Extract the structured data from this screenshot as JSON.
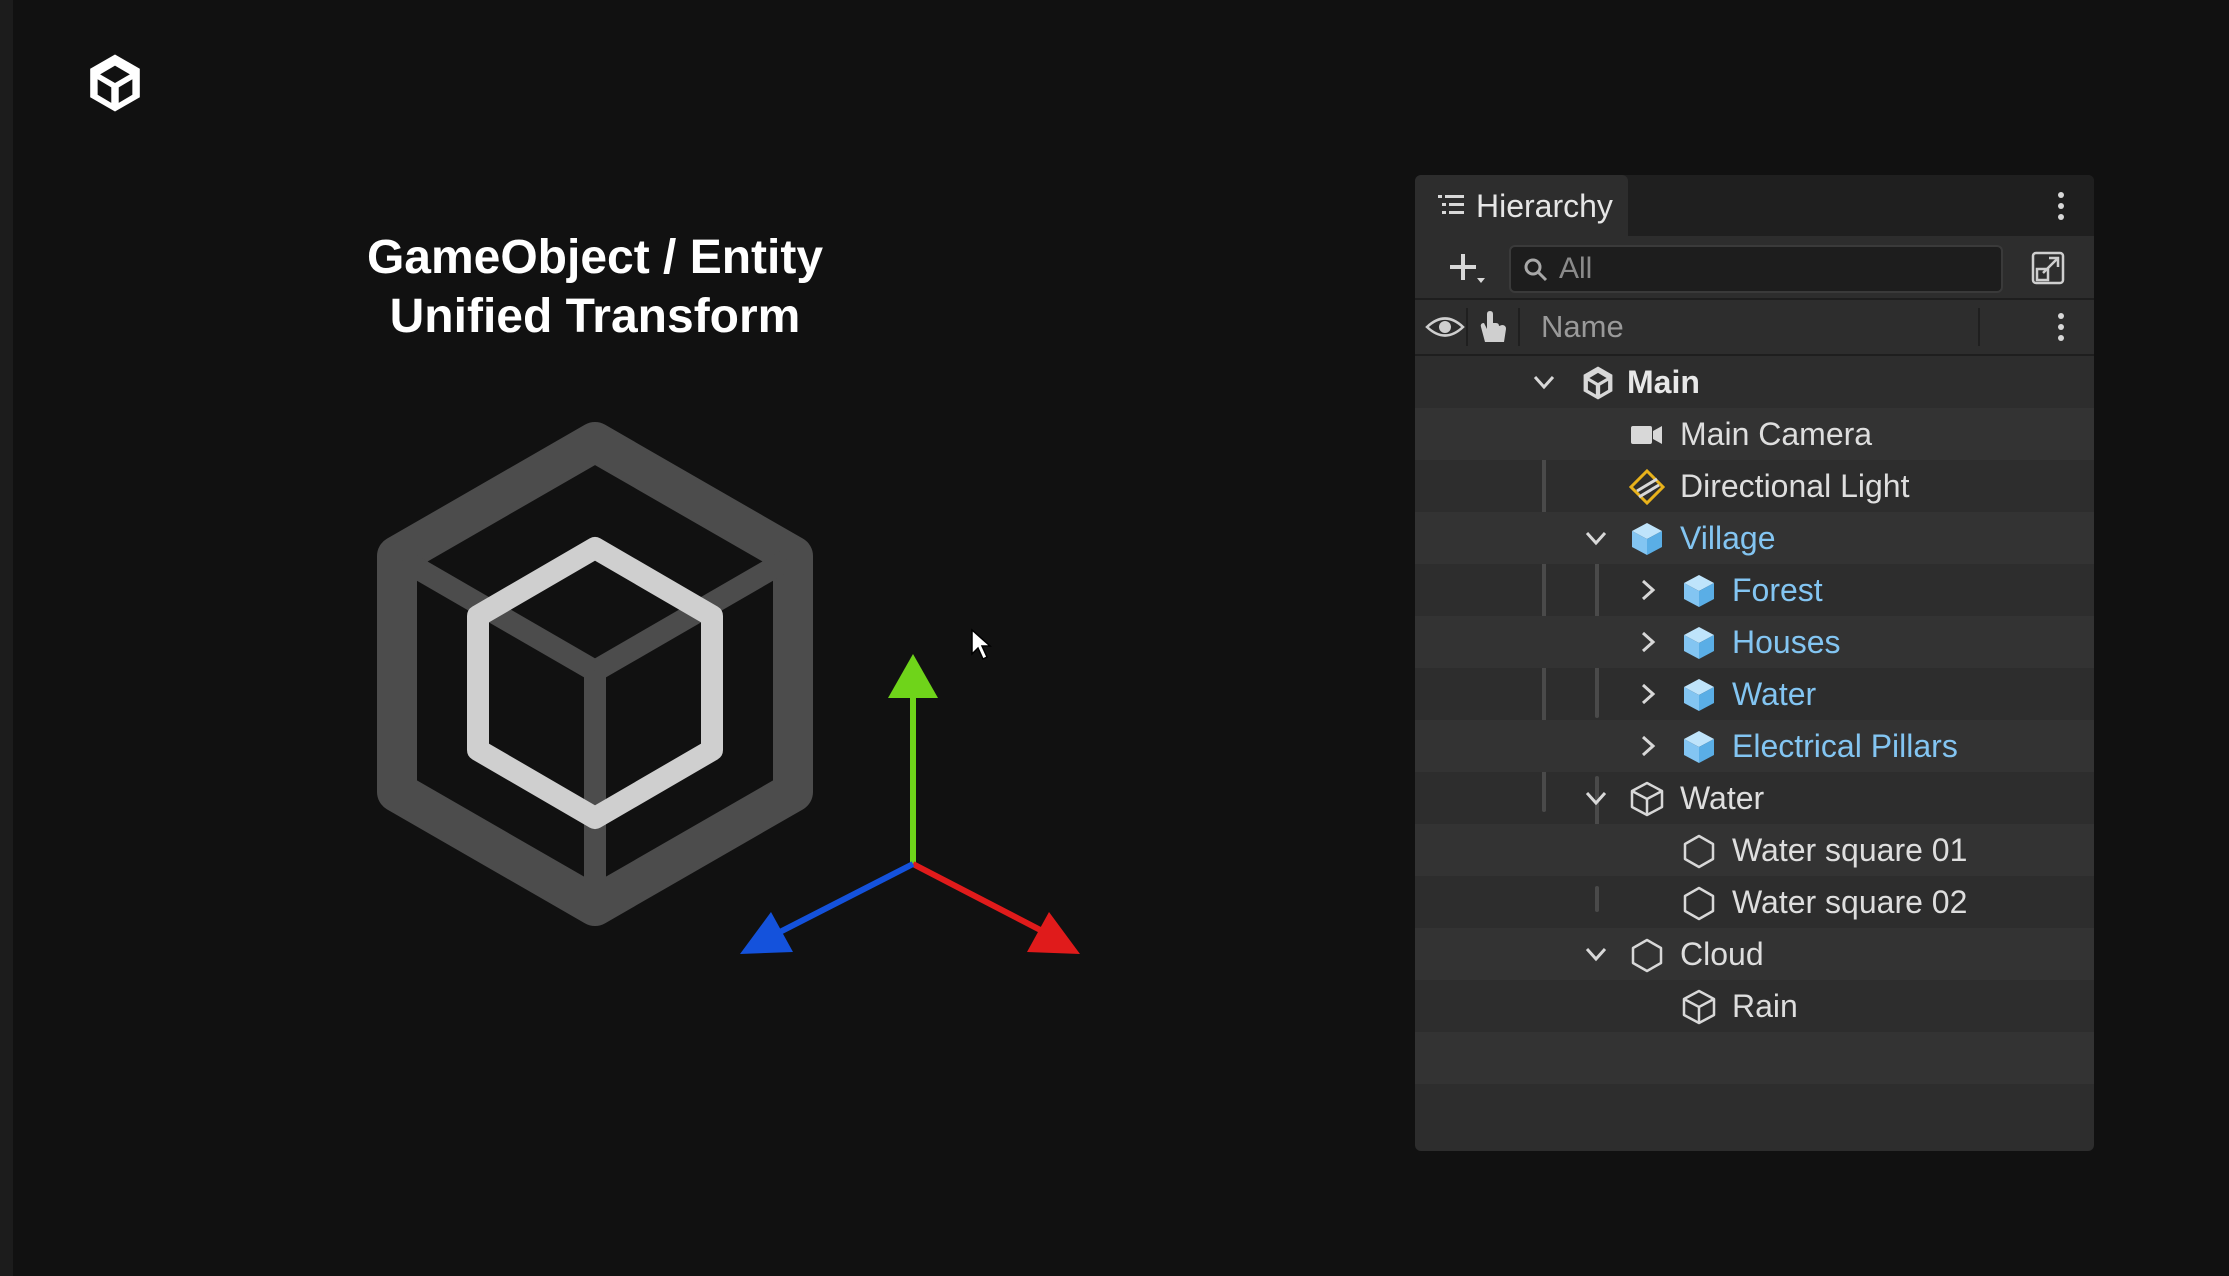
{
  "title": {
    "line1": "GameObject / Entity",
    "line2": "Unified Transform"
  },
  "colors": {
    "background": "#111111",
    "axis_x": "#e01b1b",
    "axis_y": "#6fd41a",
    "axis_z": "#1452dc",
    "prefab_blue": "#83c5f2",
    "light_yellow": "#e8b21b"
  },
  "hierarchy": {
    "tab_label": "Hierarchy",
    "search_placeholder": "All",
    "column_name": "Name",
    "rows": [
      {
        "label": "Main",
        "icon": "unity-scene-icon",
        "expanded": true
      },
      {
        "label": "Main Camera",
        "icon": "camera-icon"
      },
      {
        "label": "Directional Light",
        "icon": "directional-light-icon"
      },
      {
        "label": "Village",
        "icon": "prefab-cube-icon",
        "expanded": true
      },
      {
        "label": "Forest",
        "icon": "prefab-cube-icon",
        "expanded": false
      },
      {
        "label": "Houses",
        "icon": "prefab-cube-icon",
        "expanded": false
      },
      {
        "label": "Water",
        "icon": "prefab-cube-icon",
        "expanded": false
      },
      {
        "label": "Electrical Pillars",
        "icon": "prefab-cube-icon",
        "expanded": false
      },
      {
        "label": "Water",
        "icon": "gameobject-cube-icon",
        "expanded": true
      },
      {
        "label": "Water square 01",
        "icon": "entity-hexagon-icon"
      },
      {
        "label": "Water square 02",
        "icon": "entity-hexagon-icon"
      },
      {
        "label": "Cloud",
        "icon": "entity-hexagon-icon",
        "expanded": true
      },
      {
        "label": "Rain",
        "icon": "gameobject-cube-icon"
      }
    ]
  }
}
